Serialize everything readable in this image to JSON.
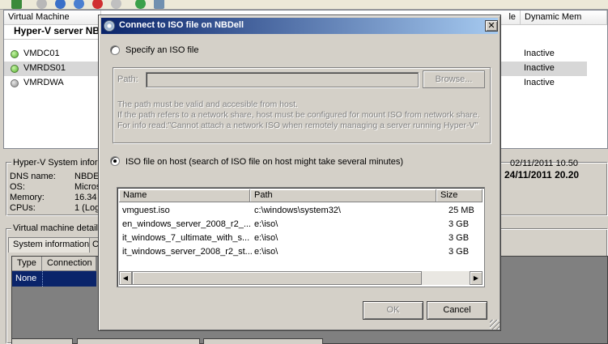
{
  "toolbar": {
    "icons": [
      "vm-icon",
      "back-icon",
      "forward-icon",
      "stop-icon",
      "pause-icon",
      "power-icon",
      "refresh-icon",
      "settings-icon"
    ]
  },
  "vmlist": {
    "columns": {
      "name": "Virtual Machine",
      "col_le": "le",
      "dynamic_mem": "Dynamic Mem"
    },
    "group": "Hyper-V server NB",
    "rows": [
      {
        "name": "VMDC01",
        "status": "on",
        "dynamic_mem": "Inactive"
      },
      {
        "name": "VMRDS01",
        "status": "on",
        "dynamic_mem": "Inactive"
      },
      {
        "name": "VMRDWA",
        "status": "off",
        "dynamic_mem": "Inactive"
      }
    ]
  },
  "system_info": {
    "title": "Hyper-V System inform",
    "rows": [
      {
        "label": "DNS name:",
        "value": "NBDE"
      },
      {
        "label": "OS:",
        "value": "Micros"
      },
      {
        "label": "Memory:",
        "value": "16.34"
      },
      {
        "label": "CPUs:",
        "value": "1 (Log"
      }
    ],
    "date1": "02/11/2011 10.50",
    "date2": "24/11/2011 20.20"
  },
  "details": {
    "title": "Virtual machine details",
    "tabs": [
      "System information",
      "C"
    ],
    "grid_columns": [
      "Type",
      "Connection"
    ],
    "selected_value": "None"
  },
  "dialog": {
    "title": "Connect to ISO file on NBDell",
    "close_label": "✕",
    "option_specify": "Specify an ISO file",
    "path_label": "Path:",
    "path_value": "",
    "browse_label": "Browse...",
    "notes": [
      "The path must be valid and accesible from host.",
      "If the path refers to a network share, host must be configured for mount ISO from network share.",
      "For info read:\"Cannot attach a network ISO when remotely managing a server running Hyper-V\""
    ],
    "option_host": "ISO file on host (search of ISO file on host might take several minutes)",
    "selected_option": "host",
    "file_list": {
      "columns": {
        "name": "Name",
        "path": "Path",
        "size": "Size"
      },
      "rows": [
        {
          "name": "vmguest.iso",
          "path": "c:\\windows\\system32\\",
          "size": "25 MB"
        },
        {
          "name": "en_windows_server_2008_r2_...",
          "path": "e:\\iso\\",
          "size": "3 GB"
        },
        {
          "name": "it_windows_7_ultimate_with_s...",
          "path": "e:\\iso\\",
          "size": "3 GB"
        },
        {
          "name": "it_windows_server_2008_r2_st...",
          "path": "e:\\iso\\",
          "size": "3 GB"
        }
      ]
    },
    "ok_label": "OK",
    "cancel_label": "Cancel"
  }
}
